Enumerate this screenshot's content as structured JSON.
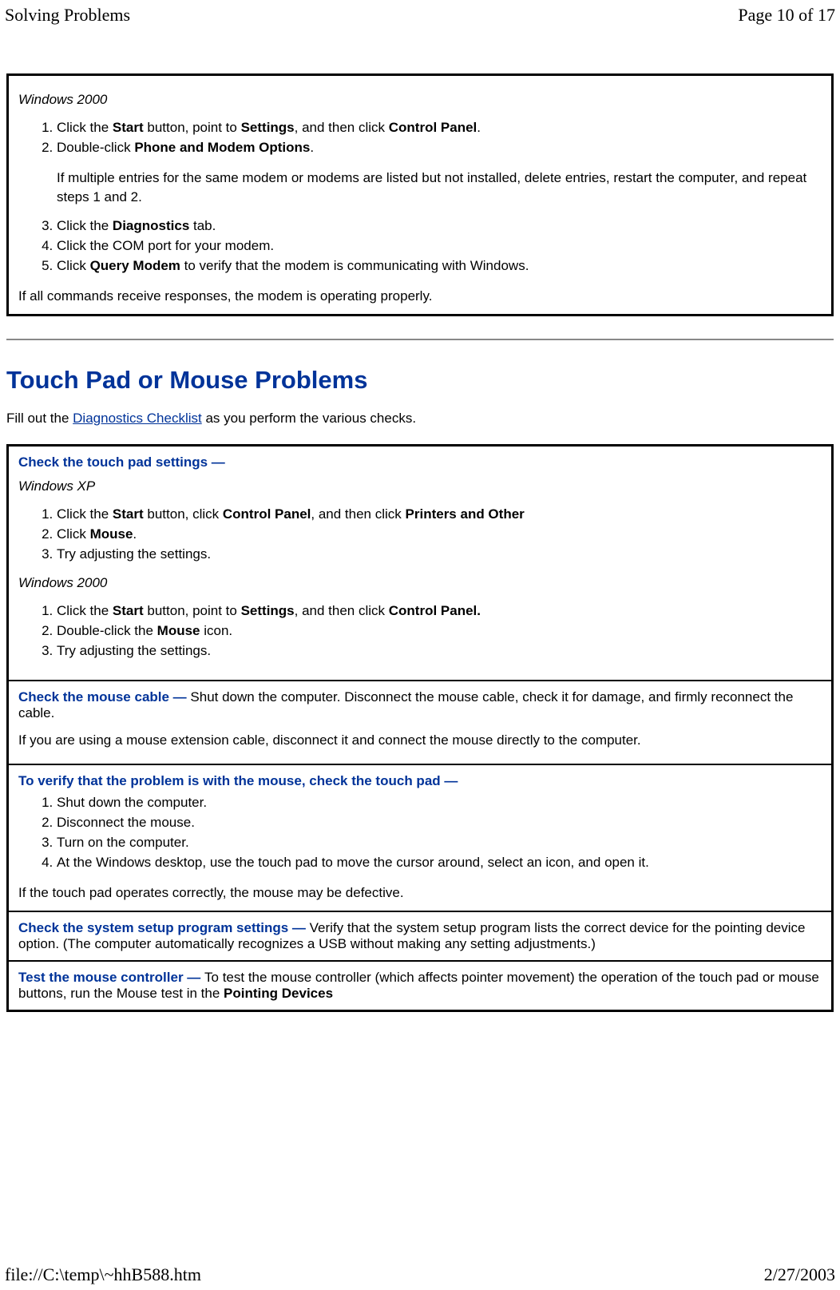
{
  "header": {
    "title": "Solving Problems",
    "page_label": "Page 10 of 17"
  },
  "box1": {
    "os_label": "Windows 2000",
    "step1_pre": "Click the ",
    "step1_b1": "Start",
    "step1_mid1": " button, point to ",
    "step1_b2": "Settings",
    "step1_mid2": ", and then click ",
    "step1_b3": "Control Panel",
    "step1_post": ".",
    "step2_pre": "Double-click ",
    "step2_b1": "Phone and Modem Options",
    "step2_post": ".",
    "note": "If multiple entries for the same modem or modems are listed but not installed, delete entries, restart the computer, and repeat steps 1 and 2.",
    "step3_pre": "Click the ",
    "step3_b1": "Diagnostics",
    "step3_post": " tab.",
    "step4": "Click the COM port for your modem.",
    "step5_pre": "Click ",
    "step5_b1": "Query Modem",
    "step5_post": " to verify that the modem is communicating with Windows.",
    "closing": "If all commands receive responses, the modem is operating properly."
  },
  "section2": {
    "heading": "Touch Pad or Mouse Problems",
    "intro_pre": "Fill out the ",
    "intro_link": "Diagnostics Checklist",
    "intro_post": " as you perform the various checks."
  },
  "box2": {
    "cell1": {
      "title": "Check the touch pad settings —",
      "xp_label": "Windows XP",
      "xp1_pre": "Click the ",
      "xp1_b1": "Start",
      "xp1_mid1": " button, click ",
      "xp1_b2": "Control Panel",
      "xp1_mid2": ", and then click ",
      "xp1_b3": "Printers and Other",
      "xp2_pre": "Click ",
      "xp2_b1": "Mouse",
      "xp2_post": ".",
      "xp3": "Try adjusting the settings.",
      "w2k_label": "Windows 2000",
      "w2k1_pre": "Click the ",
      "w2k1_b1": "Start",
      "w2k1_mid1": " button, point to ",
      "w2k1_b2": "Settings",
      "w2k1_mid2": ", and then click ",
      "w2k1_b3": "Control Panel.",
      "w2k2_pre": "Double-click the ",
      "w2k2_b1": "Mouse",
      "w2k2_post": " icon.",
      "w2k3": "Try adjusting the settings."
    },
    "cell2": {
      "title": "Check the mouse cable — ",
      "body1": "Shut down the computer. Disconnect the mouse cable, check it for damage, and firmly reconnect the cable.",
      "body2": "If you are using a mouse extension cable, disconnect it and connect the mouse directly to the computer."
    },
    "cell3": {
      "title": "To verify that the problem is with the mouse, check the touch pad —",
      "s1": "Shut down the computer.",
      "s2": "Disconnect the mouse.",
      "s3": "Turn on the computer.",
      "s4": "At the Windows desktop, use the touch pad to move the cursor around, select an icon, and open it.",
      "closing": "If the touch pad operates correctly, the mouse may be defective."
    },
    "cell4": {
      "title": "Check the system setup program settings — ",
      "body": "Verify that the system setup program lists the correct device for the pointing device option. (The computer automatically recognizes a USB without making any setting adjustments.)"
    },
    "cell5": {
      "title": "Test the mouse controller — ",
      "body_pre": "To test the mouse controller (which affects pointer movement) the operation of the touch pad or mouse buttons, run the Mouse test in the ",
      "body_b1": "Pointing Devices"
    }
  },
  "footer": {
    "path": "file://C:\\temp\\~hhB588.htm",
    "date": "2/27/2003"
  }
}
